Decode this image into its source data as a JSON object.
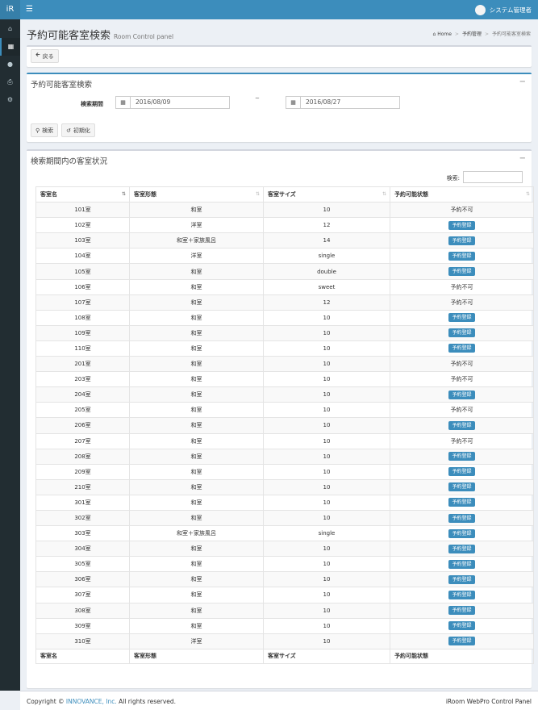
{
  "app": {
    "logo": "iR",
    "menu_icon": "hamburger-icon"
  },
  "user": {
    "name": "システム管理者"
  },
  "page": {
    "title": "予約可能客室検索",
    "subtitle": "Room Control panel"
  },
  "breadcrumb": {
    "home": "Home",
    "section": "予約管理",
    "current": "予約可能客室検索"
  },
  "back_button": "戻る",
  "search_box": {
    "title": "予約可能客室検索",
    "period_label": "検索期間",
    "date_from": "2016/08/09",
    "separator": "~",
    "date_to": "2016/08/27",
    "search_button": "検索",
    "reset_button": "初期化"
  },
  "results_box": {
    "title": "検索期間内の客室状況",
    "search_label": "検索:",
    "search_value": "",
    "columns": [
      "客室名",
      "客室形態",
      "客室サイズ",
      "予約可能状態"
    ],
    "rows": [
      {
        "name": "101室",
        "type": "和室",
        "size": "10",
        "status": "予約不可"
      },
      {
        "name": "102室",
        "type": "洋室",
        "size": "12",
        "status": "予約登録"
      },
      {
        "name": "103室",
        "type": "和室＋家族風呂",
        "size": "14",
        "status": "予約登録"
      },
      {
        "name": "104室",
        "type": "洋室",
        "size": "single",
        "status": "予約登録"
      },
      {
        "name": "105室",
        "type": "和室",
        "size": "double",
        "status": "予約登録"
      },
      {
        "name": "106室",
        "type": "和室",
        "size": "sweet",
        "status": "予約不可"
      },
      {
        "name": "107室",
        "type": "和室",
        "size": "12",
        "status": "予約不可"
      },
      {
        "name": "108室",
        "type": "和室",
        "size": "10",
        "status": "予約登録"
      },
      {
        "name": "109室",
        "type": "和室",
        "size": "10",
        "status": "予約登録"
      },
      {
        "name": "110室",
        "type": "和室",
        "size": "10",
        "status": "予約登録"
      },
      {
        "name": "201室",
        "type": "和室",
        "size": "10",
        "status": "予約不可"
      },
      {
        "name": "203室",
        "type": "和室",
        "size": "10",
        "status": "予約不可"
      },
      {
        "name": "204室",
        "type": "和室",
        "size": "10",
        "status": "予約登録"
      },
      {
        "name": "205室",
        "type": "和室",
        "size": "10",
        "status": "予約不可"
      },
      {
        "name": "206室",
        "type": "和室",
        "size": "10",
        "status": "予約登録"
      },
      {
        "name": "207室",
        "type": "和室",
        "size": "10",
        "status": "予約不可"
      },
      {
        "name": "208室",
        "type": "和室",
        "size": "10",
        "status": "予約登録"
      },
      {
        "name": "209室",
        "type": "和室",
        "size": "10",
        "status": "予約登録"
      },
      {
        "name": "210室",
        "type": "和室",
        "size": "10",
        "status": "予約登録"
      },
      {
        "name": "301室",
        "type": "和室",
        "size": "10",
        "status": "予約登録"
      },
      {
        "name": "302室",
        "type": "和室",
        "size": "10",
        "status": "予約登録"
      },
      {
        "name": "303室",
        "type": "和室＋家族風呂",
        "size": "single",
        "status": "予約登録"
      },
      {
        "name": "304室",
        "type": "和室",
        "size": "10",
        "status": "予約登録"
      },
      {
        "name": "305室",
        "type": "和室",
        "size": "10",
        "status": "予約登録"
      },
      {
        "name": "306室",
        "type": "和室",
        "size": "10",
        "status": "予約登録"
      },
      {
        "name": "307室",
        "type": "和室",
        "size": "10",
        "status": "予約登録"
      },
      {
        "name": "308室",
        "type": "和室",
        "size": "10",
        "status": "予約登録"
      },
      {
        "name": "309室",
        "type": "和室",
        "size": "10",
        "status": "予約登録"
      },
      {
        "name": "310室",
        "type": "洋室",
        "size": "10",
        "status": "予約登録"
      }
    ],
    "bookable_status": "予約登録"
  },
  "footer": {
    "copyright_prefix": "Copyright © ",
    "company": "INNOVANCE, Inc.",
    "rights": " All rights reserved.",
    "product": "iRoom WebPro Control Panel"
  },
  "colors": {
    "accent": "#3c8dbc",
    "sidebar": "#222d32",
    "background": "#ecf0f5"
  }
}
